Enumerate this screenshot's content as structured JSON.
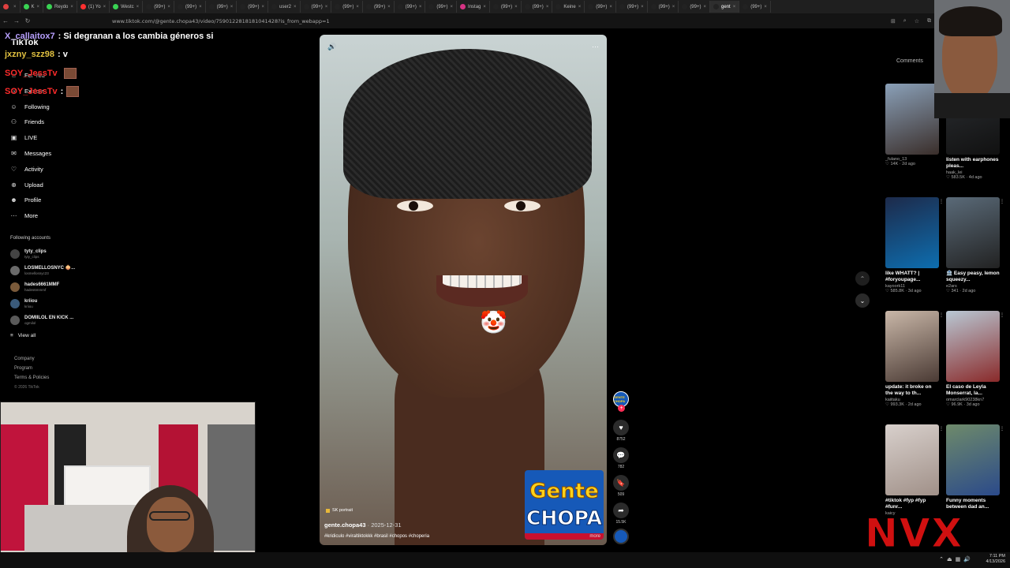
{
  "browser": {
    "tabs": [
      {
        "label": "",
        "color": "#e04040"
      },
      {
        "label": "K",
        "color": "#39d353"
      },
      {
        "label": "Reydo",
        "color": "#39d353"
      },
      {
        "label": "(1) Yo",
        "color": "#ff3030"
      },
      {
        "label": "Westc",
        "color": "#39d353"
      },
      {
        "label": "(99+)",
        "color": "#222"
      },
      {
        "label": "(99+)",
        "color": "#222"
      },
      {
        "label": "(99+)",
        "color": "#222"
      },
      {
        "label": "(99+)",
        "color": "#222"
      },
      {
        "label": "user2",
        "color": "#222"
      },
      {
        "label": "(99+)",
        "color": "#222"
      },
      {
        "label": "(99+)",
        "color": "#222"
      },
      {
        "label": "(99+)",
        "color": "#222"
      },
      {
        "label": "(99+)",
        "color": "#222"
      },
      {
        "label": "(99+)",
        "color": "#222"
      },
      {
        "label": "Instag",
        "color": "#d63384"
      },
      {
        "label": "(99+)",
        "color": "#222"
      },
      {
        "label": "(99+)",
        "color": "#222"
      },
      {
        "label": "Keine",
        "color": "#222"
      },
      {
        "label": "(99+)",
        "color": "#222"
      },
      {
        "label": "(99+)",
        "color": "#222"
      },
      {
        "label": "(99+)",
        "color": "#222"
      },
      {
        "label": "(99+)",
        "color": "#222"
      },
      {
        "label": "gent",
        "color": "#222"
      },
      {
        "label": "(99+)",
        "color": "#222"
      }
    ],
    "url": "www.tiktok.com/@gente.chopa43/video/7590122818181041428?is_from_webapp=1"
  },
  "chat": [
    {
      "user": "X_callaitox7",
      "message": ": Si degranan a los cambia géneros si",
      "emote": false
    },
    {
      "user": "jxzny_szz98",
      "message": ": v",
      "emote": false
    },
    {
      "user": "SOY_JessTv",
      "message": "",
      "emote": true
    },
    {
      "user": "SOY_JessTv",
      "message": ":",
      "emote": true
    }
  ],
  "sidebar": {
    "logo": "TikTok",
    "items": [
      {
        "label": "For You",
        "icon": "home-icon"
      },
      {
        "label": "Explore",
        "icon": "compass-icon"
      },
      {
        "label": "Following",
        "icon": "following-icon"
      },
      {
        "label": "Friends",
        "icon": "friends-icon"
      },
      {
        "label": "LIVE",
        "icon": "live-icon"
      },
      {
        "label": "Messages",
        "icon": "messages-icon"
      },
      {
        "label": "Activity",
        "icon": "activity-icon"
      },
      {
        "label": "Upload",
        "icon": "upload-icon"
      },
      {
        "label": "Profile",
        "icon": "profile-icon"
      },
      {
        "label": "More",
        "icon": "more-icon"
      }
    ],
    "following_header": "Following accounts",
    "following": [
      {
        "name": "tyty_clips",
        "handle": "tyty_clips"
      },
      {
        "name": "LOSMELLOSNYC 🧅...",
        "handle": "losmellosnyc23"
      },
      {
        "name": "hades6661MMF",
        "handle": "hades6mmmf"
      },
      {
        "name": "kriiou",
        "handle": "kriiou"
      },
      {
        "name": "DOMIILOL EN KICK ...",
        "handle": "ogmilol"
      }
    ],
    "view_all": "View all",
    "footer": [
      "Company",
      "Program",
      "Terms & Policies"
    ],
    "copyright": "© 2026 TikTok"
  },
  "video": {
    "quality_badge": "SK portrait",
    "author": "gente.chopa43",
    "date": "· 2025-12-31",
    "tags": "#kridiculo #viraltiktokkk #brasil #chopos #choperia",
    "more_label": "more",
    "logo_line1": "Gente",
    "logo_line2": "CHOPA",
    "avatar_label": "GENTE CHOPA"
  },
  "actions": {
    "likes": "8752",
    "comments": "782",
    "saves": "509",
    "shares": "15.5K"
  },
  "right_panel": {
    "tab": "Comments",
    "cards": [
      {
        "title": "",
        "user": "_fulano_13",
        "stats": "♡ 14K · 2d ago",
        "color1": "#8aa0b8",
        "color2": "#3a2e2a"
      },
      {
        "title": "listen with earphones pleas...",
        "user": "haak_lei",
        "stats": "♡ 583.5K · 4d ago",
        "color1": "#2c2f33",
        "color2": "#111"
      },
      {
        "title": "like WHATT? | #foryoupage...",
        "user": "kayoork11",
        "stats": "♡ 585.8K · 3d ago",
        "color1": "#1d2a4a",
        "color2": "#0d6eb0"
      },
      {
        "title": "🏦 Easy peasy, lemon squeezy...",
        "user": "e2ars",
        "stats": "♡ 341 · 2d ago",
        "color1": "#5a6a78",
        "color2": "#222"
      },
      {
        "title": "update: it broke on the way to th...",
        "user": "kaiitaku",
        "stats": "♡ 993.3K · 2d ago",
        "color1": "#c9b7a8",
        "color2": "#4a3a34"
      },
      {
        "title": "El caso de Leyla Monserrat, la...",
        "user": "omarclark90238kn7",
        "stats": "♡ 96.9K · 3d ago",
        "color1": "#b9c8d4",
        "color2": "#8a2a2a"
      },
      {
        "title": "#tiktok #fyp #fyp #funr...",
        "user": "kaicy",
        "stats": "",
        "color1": "#d8d0cc",
        "color2": "#a09088"
      },
      {
        "title": "Funny moments between dad an...",
        "user": "",
        "stats": "",
        "color1": "#6e8a6a",
        "color2": "#2b4a8a"
      }
    ]
  },
  "overlay": {
    "brand": "NVX"
  },
  "taskbar": {
    "time": "7:11 PM",
    "date": "4/13/2026"
  }
}
